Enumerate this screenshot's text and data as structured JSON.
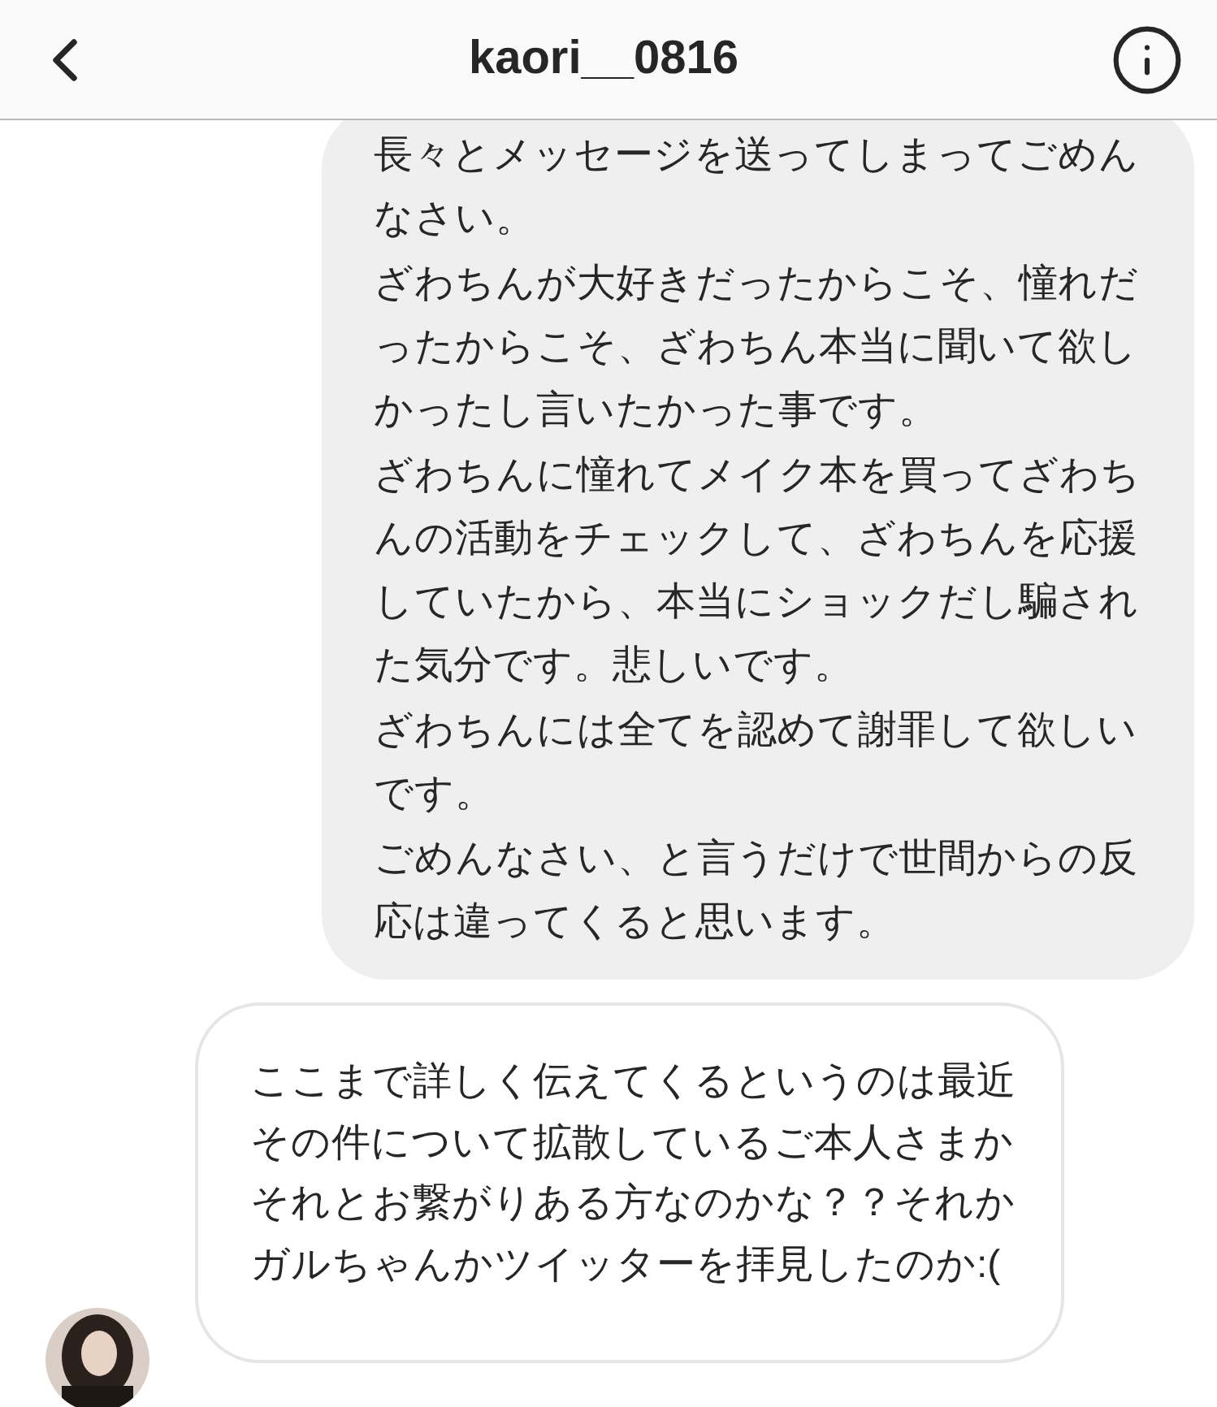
{
  "header": {
    "title": "kaori__0816"
  },
  "messages": [
    {
      "kind": "sent",
      "paragraphs": [
        "長々とメッセージを送ってしまってごめんなさい。",
        "ざわちんが大好きだったからこそ、憧れだったからこそ、ざわちん本当に聞いて欲しかったし言いたかった事です。",
        "ざわちんに憧れてメイク本を買ってざわちんの活動をチェックして、ざわちんを応援していたから、本当にショックだし騙された気分です。悲しいです。",
        "ざわちんには全てを認めて謝罪して欲しいです。",
        "ごめんなさい、と言うだけで世間からの反応は違ってくると思います。"
      ]
    },
    {
      "kind": "received",
      "paragraphs": [
        "ここまで詳しく伝えてくるというのは最近その件について拡散しているご本人さまかそれとお繋がりある方なのかな？？それかガルちゃんかツイッターを拝見したのか:("
      ]
    }
  ]
}
